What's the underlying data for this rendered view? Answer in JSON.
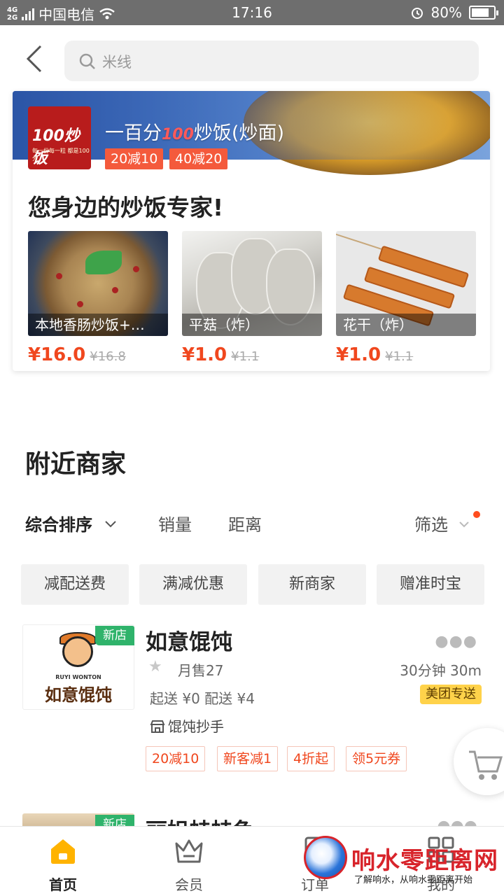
{
  "status_bar": {
    "network": "4G 2G",
    "carrier": "中国电信",
    "time": "17:16",
    "battery": "80%",
    "battery_level": 0.8
  },
  "search": {
    "placeholder": "米线"
  },
  "promo": {
    "shop_name_prefix": "一百分",
    "shop_name_emoji": "100",
    "shop_name_suffix": "炒饭(炒面)",
    "logo_text": "100炒饭",
    "logo_small": "每一份每一粒 都是100分",
    "tags": [
      "20减10",
      "40减20"
    ],
    "slogan": "您身边的炒饭专家!",
    "dishes": [
      {
        "name": "本地香肠炒饭+…",
        "price": "¥16.0",
        "old_price": "¥16.8"
      },
      {
        "name": "平菇（炸）",
        "price": "¥1.0",
        "old_price": "¥1.1"
      },
      {
        "name": "花干（炸）",
        "price": "¥1.0",
        "old_price": "¥1.1"
      }
    ]
  },
  "nearby": {
    "title": "附近商家",
    "sort_tabs": [
      "综合排序",
      "销量",
      "距离",
      "筛选"
    ],
    "filter_chips": [
      "减配送费",
      "满减优惠",
      "新商家",
      "赠准时宝"
    ]
  },
  "stores": [
    {
      "badge": "新店",
      "logo_en": "RUYI WONTON",
      "logo_cn": "如意馄饨",
      "name": "如意馄饨",
      "sales": "月售27",
      "time_distance": "30分钟  30m",
      "delivery_info": "起送 ¥0  配送 ¥4",
      "delivery_badge": "美团专送",
      "category": "馄饨抄手",
      "tags": [
        "20减10",
        "新客减1",
        "4折起",
        "领5元券"
      ]
    },
    {
      "badge": "新店",
      "name": "丽姐蛙蛙鱼"
    }
  ],
  "bottom_nav": {
    "items": [
      {
        "label": "首页",
        "icon": "home-icon"
      },
      {
        "label": "会员",
        "icon": "member-crown-icon"
      },
      {
        "label": "订单",
        "icon": "order-icon"
      },
      {
        "label": "我的",
        "icon": "grid-icon"
      }
    ]
  },
  "watermark": {
    "title": "响水零距离网",
    "subtitle": "了解响水，从响水零距离开始"
  },
  "colors": {
    "accent_orange": "#f0471e",
    "promo_tag": "#f45a3c",
    "new_badge": "#2fb36b",
    "meituan_yellow": "#ffd24a"
  }
}
